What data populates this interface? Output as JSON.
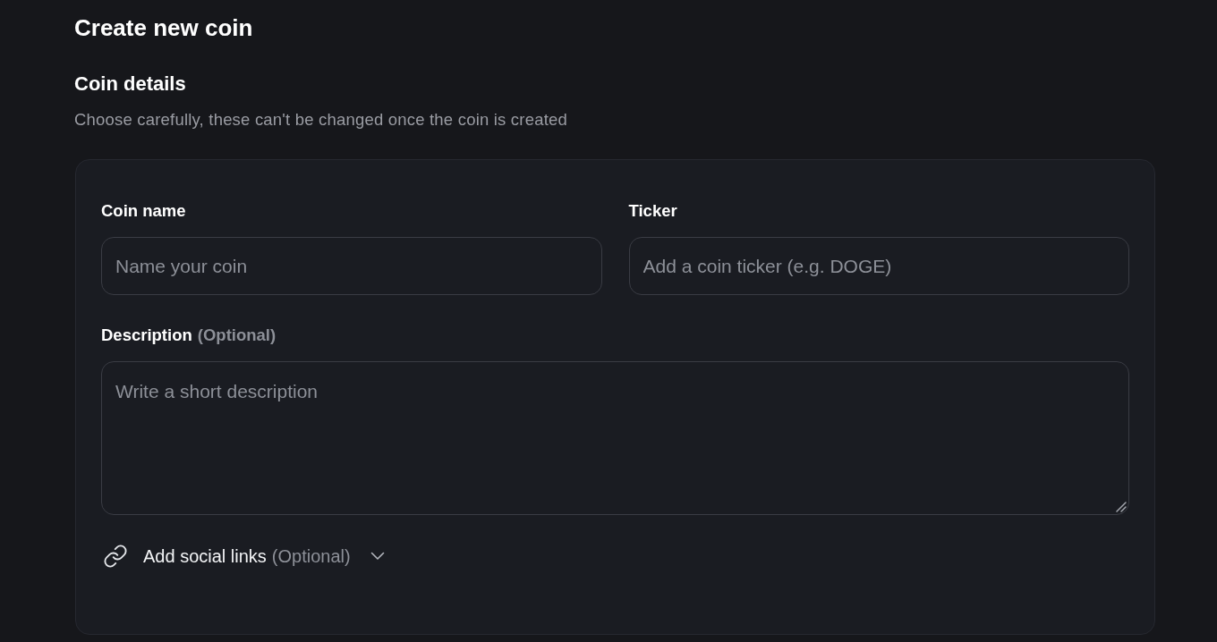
{
  "page": {
    "title": "Create new coin"
  },
  "section": {
    "title": "Coin details",
    "subtitle": "Choose carefully, these can't be changed once the coin is created"
  },
  "form": {
    "fields": [
      {
        "kind": "input",
        "label": "Coin name",
        "placeholder": "Name your coin"
      },
      {
        "kind": "input",
        "label": "Ticker",
        "placeholder": "Add a coin ticker (e.g. DOGE)"
      },
      {
        "kind": "textarea",
        "label": "Description",
        "note": "(Optional)",
        "placeholder": "Write a short description"
      }
    ],
    "social_links": {
      "label": "Add social links",
      "note": "(Optional)",
      "expanded": false
    }
  }
}
